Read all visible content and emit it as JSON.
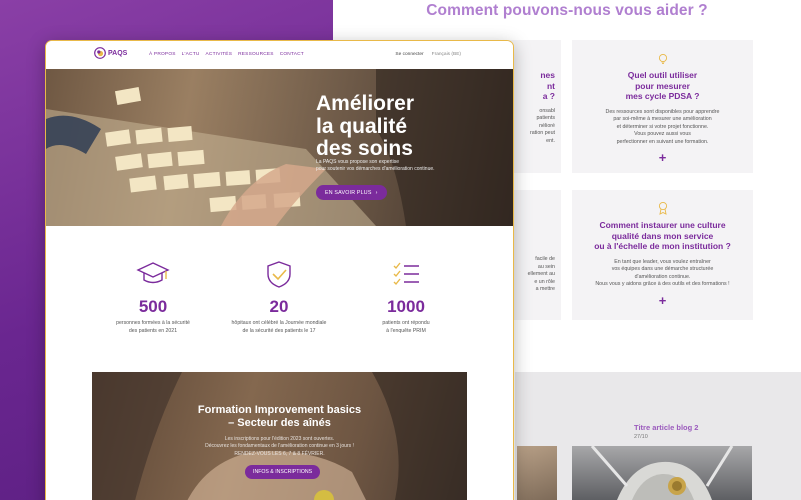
{
  "back": {
    "heading": "Comment pouvons-nous vous aider ?",
    "left_card1": {
      "title_lines": [
        "nes",
        "nt",
        "a ?"
      ],
      "body_lines": [
        "onsabl",
        "patients",
        "nélioré",
        "ration peut",
        "ent."
      ]
    },
    "left_card2": {
      "title_lines": [
        "",
        ""
      ],
      "body_lines": [
        "facile de",
        "au sein",
        "ellement au",
        "e un rôle",
        "a mettre"
      ]
    },
    "card1": {
      "title_lines": [
        "Quel outil utiliser",
        "pour mesurer",
        "mes cycle PDSA ?"
      ],
      "body_lines": [
        "Des ressources sont disponibles pour apprendre",
        "par soi-même à mesurer une amélioration",
        "et déterminer si votre projet fonctionne.",
        "Vous pouvez aussi vous",
        "perfectionner en suivant une formation."
      ],
      "plus": "+"
    },
    "card2": {
      "title_lines": [
        "Comment instaurer une culture",
        "qualité dans mon service",
        "ou à l'échelle de mon institution ?"
      ],
      "body_lines": [
        "En tant que leader, vous voulez entraîner",
        "vos équipes dans une démarche structurée",
        "d'amélioration continue.",
        "Nous vous y aidons grâce à des outils et des formations !"
      ],
      "plus": "+"
    },
    "blog": {
      "title": "Titre article blog 2",
      "date": "27/10"
    }
  },
  "front": {
    "logo": "PAQS",
    "menu": [
      "À PROPOS",
      "L'ACTU",
      "ACTIVITÉS",
      "RESSOURCES",
      "CONTACT"
    ],
    "connect": "Se connecter",
    "lang": "Français (BE)",
    "hero": {
      "title_lines": [
        "Améliorer",
        "la qualité",
        "des soins"
      ],
      "sub_lines": [
        "La PAQS vous propose son expertise",
        "pour soutenir vos démarches d'amélioration continue."
      ],
      "button": "EN SAVOIR PLUS",
      "button_arrow": "›"
    },
    "stats": [
      {
        "number": "500",
        "lines": [
          "personnes formées à la sécurité",
          "des patients en 2021"
        ]
      },
      {
        "number": "20",
        "lines": [
          "hôpitaux ont célébré la Journée mondiale",
          "de la sécurité des patients le 17"
        ]
      },
      {
        "number": "1000",
        "lines": [
          "patients ont répondu",
          "à l'enquête PRIM"
        ]
      }
    ],
    "formation": {
      "title_lines": [
        "Formation Improvement basics",
        "– Secteur des aînés"
      ],
      "body_lines": [
        "Les inscriptions pour l'édition 2023 sont ouvertes.",
        "Découvrez les fondamentaux de l'amélioration continue en 3 jours !",
        "RENDEZ-VOUS LES 6, 7 & 8 FÉVRIER."
      ],
      "button": "INFOS & INSCRIPTIONS"
    }
  },
  "colors": {
    "purple": "#7b2b9c",
    "light_purple": "#b07fd0",
    "gold": "#e9b949"
  }
}
